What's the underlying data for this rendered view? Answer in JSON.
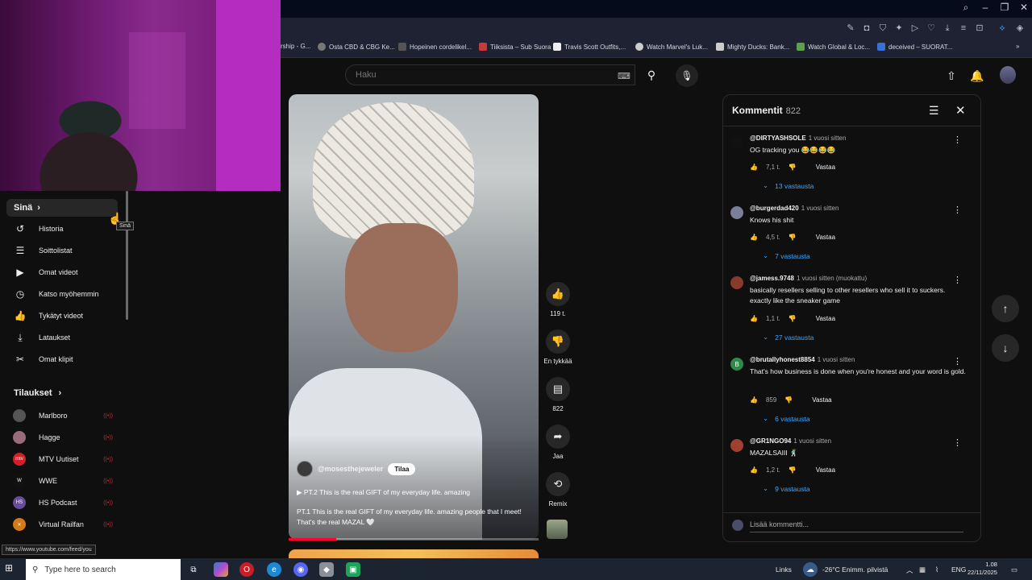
{
  "browser": {
    "bookmarks": [
      {
        "label": "rship - G...",
        "color": "#888"
      },
      {
        "label": "Osta CBD & CBG Ke...",
        "color": "#777"
      },
      {
        "label": "Hopeinen cordelikel...",
        "color": "#555"
      },
      {
        "label": "Tiiksista – Sub Suora",
        "color": "#c83a3a"
      },
      {
        "label": "Travis Scott Outfits,...",
        "color": "#eee"
      },
      {
        "label": "Watch Marvel's Luk...",
        "color": "#ccc"
      },
      {
        "label": "Mighty Ducks: Bank...",
        "color": "#ccc"
      },
      {
        "label": "Watch Global & Loc...",
        "color": "#5ca04a"
      },
      {
        "label": "deceived – SUORAT...",
        "color": "#3b6fd6"
      }
    ]
  },
  "header": {
    "search_placeholder": "Haku"
  },
  "sidebar": {
    "you_label": "Sinä",
    "tooltip": "Sinä",
    "items": [
      {
        "label": "Historia",
        "icon": "history-icon"
      },
      {
        "label": "Soittolistat",
        "icon": "playlists-icon"
      },
      {
        "label": "Omat videot",
        "icon": "my-videos-icon"
      },
      {
        "label": "Katso myöhemmin",
        "icon": "watch-later-icon"
      },
      {
        "label": "Tykätyt videot",
        "icon": "like-icon"
      },
      {
        "label": "Lataukset",
        "icon": "download-icon"
      },
      {
        "label": "Omat klipit",
        "icon": "scissors-icon"
      }
    ],
    "subscriptions_label": "Tilaukset",
    "subscriptions": [
      {
        "label": "Marlboro",
        "color": "#555"
      },
      {
        "label": "Hagge",
        "color": "#9a6b7a"
      },
      {
        "label": "MTV Uutiset",
        "color": "#d0202a",
        "short": "mtv"
      },
      {
        "label": "WWE",
        "color": "#111",
        "short": "W"
      },
      {
        "label": "HS Podcast",
        "color": "#6a4a9a",
        "short": "HS"
      },
      {
        "label": "Virtual Railfan",
        "color": "#d47a1a",
        "short": "✕"
      }
    ],
    "status_url": "https://www.youtube.com/feed/you"
  },
  "video": {
    "channel": "@mosesthejeweler",
    "subscribe": "Tilaa",
    "playlist_line": "PT.2 This is the real GIFT of my everyday life. amazing",
    "caption": "PT.1 This is the real GIFT of my everyday life. amazing people that I meet! That's the real MAZAL 🤍",
    "progress": 0.19
  },
  "actions": {
    "likes": "119 t.",
    "dislike": "En tykkää",
    "comments": "822",
    "share": "Jaa",
    "remix": "Remix"
  },
  "comments": {
    "title": "Kommentit",
    "count": "822",
    "add_placeholder": "Lisää kommentti...",
    "reply_label": "Vastaa",
    "items": [
      {
        "author": "@DIRTYASHSOLE",
        "time": "1 vuosi sitten",
        "text": "OG tracking you 😂😂😂😂",
        "likes": "7,1 t.",
        "replies": "13 vastausta",
        "color": "#111"
      },
      {
        "author": "@burgerdad420",
        "time": "1 vuosi sitten",
        "text": "Knows his shit",
        "likes": "4,5 t.",
        "replies": "7 vastausta",
        "color": "#7a7f9a"
      },
      {
        "author": "@jamess.9748",
        "time": "1 vuosi sitten (muokattu)",
        "text": "basically resellers selling to other resellers who sell it to suckers. exactly like the sneaker game",
        "likes": "1,1 t.",
        "replies": "27 vastausta",
        "color": "#8a3a2a"
      },
      {
        "author": "@brutallyhonest8854",
        "time": "1 vuosi sitten",
        "text": "That's how business is done when you're honest and your word is gold.",
        "likes": "859",
        "replies": "6 vastausta",
        "color": "#2e8a4a",
        "initial": "B"
      },
      {
        "author": "@GR1NGO94",
        "time": "1 vuosi sitten",
        "text": "MAZALSAIII 🕺",
        "likes": "1,2 t.",
        "replies": "9 vastausta",
        "color": "#a04030"
      }
    ]
  },
  "taskbar": {
    "search_placeholder": "Type here to search",
    "links": "Links",
    "weather": "-26°C  Enimm. pilvistä",
    "lang": "ENG",
    "time": "1.08",
    "date": "22/11/2025"
  }
}
